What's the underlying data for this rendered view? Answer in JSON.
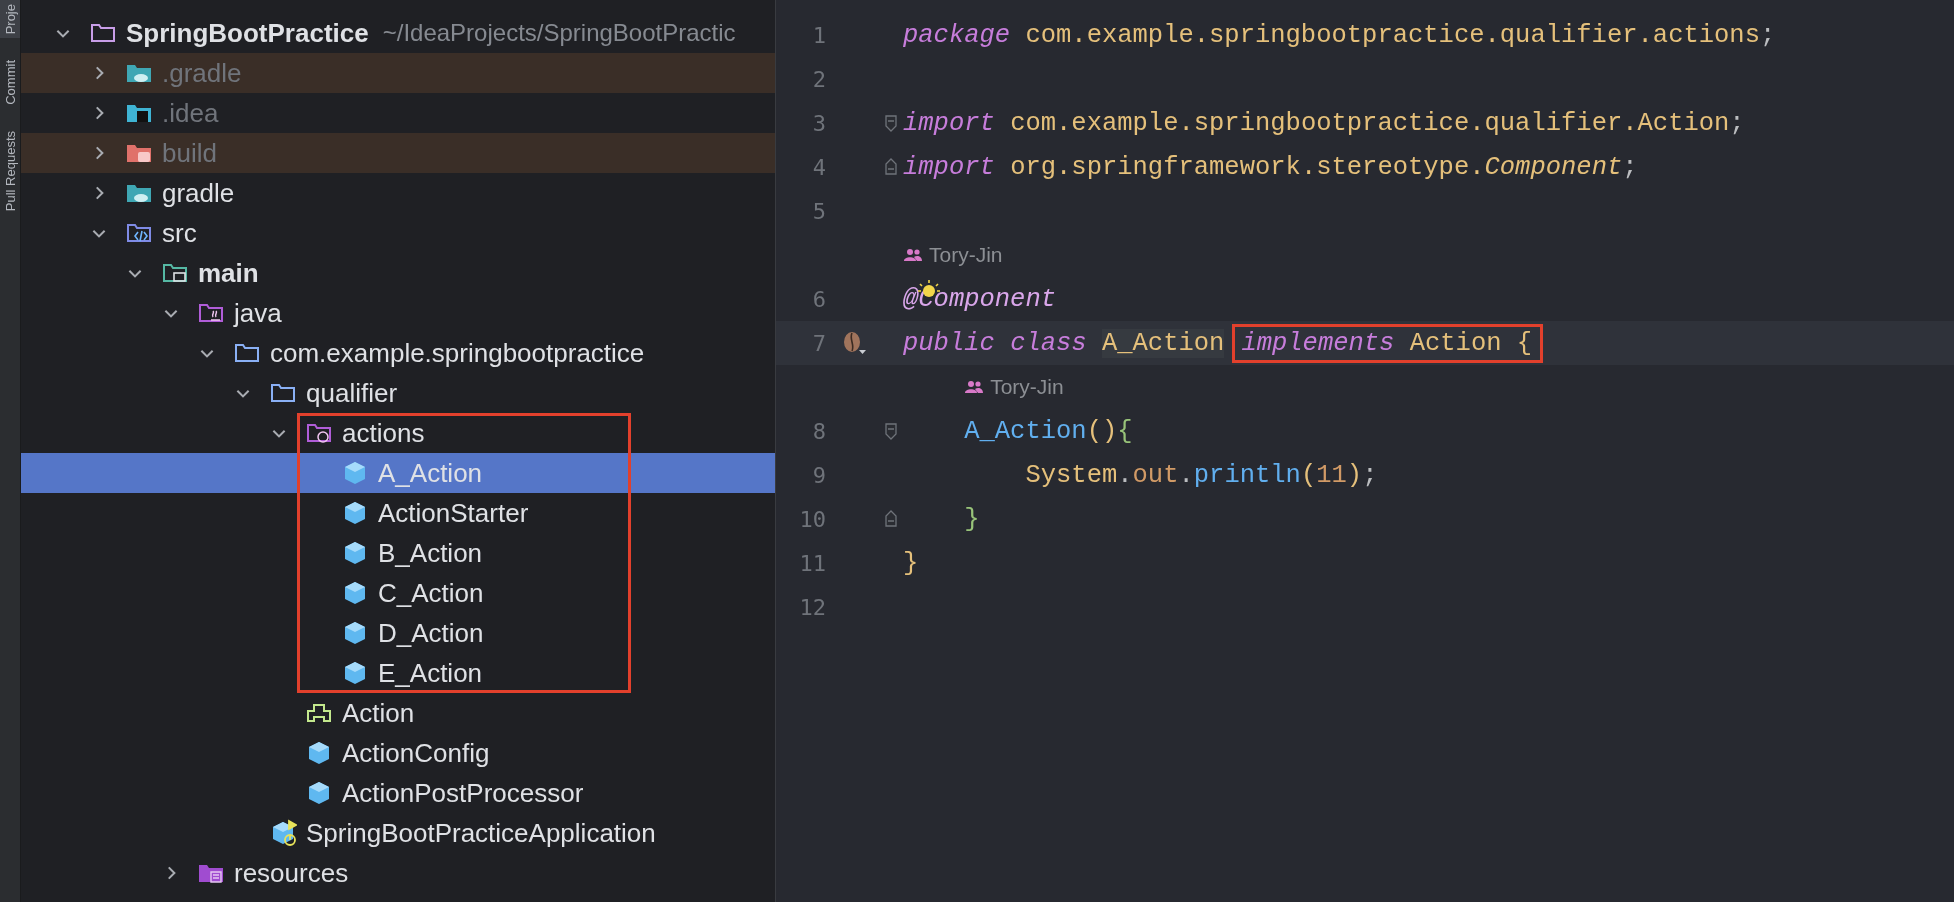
{
  "tool_strip": [
    {
      "label": "Proje",
      "selected": true
    },
    {
      "label": "Commit",
      "selected": false
    },
    {
      "label": "Pull Requests",
      "selected": false
    }
  ],
  "tree": {
    "label": "SpringBootPractice",
    "path": "~/IdeaProjects/SpringBootPractic",
    "kind": "project-folder",
    "bold": true,
    "expanded": true,
    "selected": false,
    "children": [
      {
        "label": ".gradle",
        "kind": "gradle-folder",
        "expanded": false,
        "dimmed": true,
        "ignored": true,
        "selected": false
      },
      {
        "label": ".idea",
        "kind": "idea-folder",
        "expanded": false,
        "dimmed": true,
        "selected": false
      },
      {
        "label": "build",
        "kind": "build-folder",
        "expanded": false,
        "dimmed": true,
        "ignored": true,
        "selected": false
      },
      {
        "label": "gradle",
        "kind": "gradle-folder",
        "expanded": false,
        "selected": false
      },
      {
        "label": "src",
        "kind": "source-folder",
        "expanded": true,
        "selected": false,
        "children": [
          {
            "label": "main",
            "kind": "module-folder",
            "bold": true,
            "expanded": true,
            "selected": false,
            "children": [
              {
                "label": "java",
                "kind": "java-folder",
                "expanded": true,
                "selected": false,
                "children": [
                  {
                    "label": "com.example.springbootpractice",
                    "kind": "package",
                    "expanded": true,
                    "selected": false,
                    "children": [
                      {
                        "label": "qualifier",
                        "kind": "package",
                        "expanded": true,
                        "selected": false,
                        "children": [
                          {
                            "label": "actions",
                            "kind": "bean-package",
                            "expanded": true,
                            "framed": true,
                            "selected": false,
                            "children": [
                              {
                                "label": "A_Action",
                                "kind": "class",
                                "selected": true
                              },
                              {
                                "label": "ActionStarter",
                                "kind": "class",
                                "selected": false
                              },
                              {
                                "label": "B_Action",
                                "kind": "class",
                                "selected": false
                              },
                              {
                                "label": "C_Action",
                                "kind": "class",
                                "selected": false
                              },
                              {
                                "label": "D_Action",
                                "kind": "class",
                                "selected": false
                              },
                              {
                                "label": "E_Action",
                                "kind": "class",
                                "selected": false
                              }
                            ]
                          },
                          {
                            "label": "Action",
                            "kind": "interface",
                            "selected": false
                          },
                          {
                            "label": "ActionConfig",
                            "kind": "class",
                            "selected": false
                          },
                          {
                            "label": "ActionPostProcessor",
                            "kind": "class",
                            "selected": false
                          }
                        ]
                      },
                      {
                        "label": "SpringBootPracticeApplication",
                        "kind": "spring-app",
                        "selected": false
                      }
                    ]
                  }
                ]
              },
              {
                "label": "resources",
                "kind": "resources-folder",
                "expanded": false,
                "selected": false
              }
            ]
          }
        ]
      }
    ]
  },
  "editor": {
    "lines": [
      {
        "kind": "code",
        "number": "1",
        "tokens": [
          {
            "text": "package",
            "kind": "keyword"
          },
          {
            "text": " com.example.springbootpractice.qualifier.actions",
            "kind": "plain"
          },
          {
            "text": ";",
            "kind": "punct"
          }
        ]
      },
      {
        "kind": "code",
        "number": "2"
      },
      {
        "kind": "code",
        "number": "3",
        "fold_start": true,
        "tokens": [
          {
            "text": "import",
            "kind": "keyword"
          },
          {
            "text": " com.example.springbootpractice.qualifier.Action",
            "kind": "plain"
          },
          {
            "text": ";",
            "kind": "punct"
          }
        ]
      },
      {
        "kind": "code",
        "number": "4",
        "fold_end": true,
        "tokens": [
          {
            "text": "import",
            "kind": "keyword"
          },
          {
            "text": " org.springframework.stereotype.",
            "kind": "plain"
          },
          {
            "text": "Component",
            "kind": "type"
          },
          {
            "text": ";",
            "kind": "punct"
          }
        ]
      },
      {
        "kind": "code",
        "number": "5"
      },
      {
        "kind": "author",
        "author": "Tory-Jin"
      },
      {
        "kind": "code",
        "number": "6",
        "bulb": true,
        "tokens": [
          {
            "text": "@Component",
            "kind": "annotation"
          }
        ]
      },
      {
        "kind": "code",
        "number": "7",
        "current": true,
        "bean_marker": true,
        "tokens": [
          {
            "text": "public",
            "kind": "keyword"
          },
          {
            "text": " class ",
            "kind": "keyword"
          },
          {
            "text": "A_Action",
            "kind": "highlight"
          }
        ],
        "framed_tokens": [
          {
            "text": "implements",
            "kind": "keyword"
          },
          {
            "text": " Action ",
            "kind": "plain"
          },
          {
            "text": "{",
            "kind": "brace"
          }
        ]
      },
      {
        "kind": "author",
        "author": "Tory-Jin"
      },
      {
        "kind": "code",
        "number": "8",
        "fold_start": true,
        "tokens": [
          {
            "text": "    A_Action",
            "kind": "method"
          },
          {
            "text": "()",
            "kind": "paren"
          },
          {
            "text": "{",
            "kind": "brace-green"
          }
        ]
      },
      {
        "kind": "code",
        "number": "9",
        "tokens": [
          {
            "text": "        System",
            "kind": "plain"
          },
          {
            "text": ".",
            "kind": "punct"
          },
          {
            "text": "out",
            "kind": "field"
          },
          {
            "text": ".",
            "kind": "punct"
          },
          {
            "text": "println",
            "kind": "method"
          },
          {
            "text": "(",
            "kind": "paren"
          },
          {
            "text": "11",
            "kind": "number"
          },
          {
            "text": ")",
            "kind": "paren"
          },
          {
            "text": ";",
            "kind": "punct"
          }
        ]
      },
      {
        "kind": "code",
        "number": "10",
        "fold_end": true,
        "tokens": [
          {
            "text": "    }",
            "kind": "brace-green"
          }
        ]
      },
      {
        "kind": "code",
        "number": "11",
        "tokens": [
          {
            "text": "}",
            "kind": "brace"
          }
        ]
      },
      {
        "kind": "code",
        "number": "12"
      }
    ]
  }
}
